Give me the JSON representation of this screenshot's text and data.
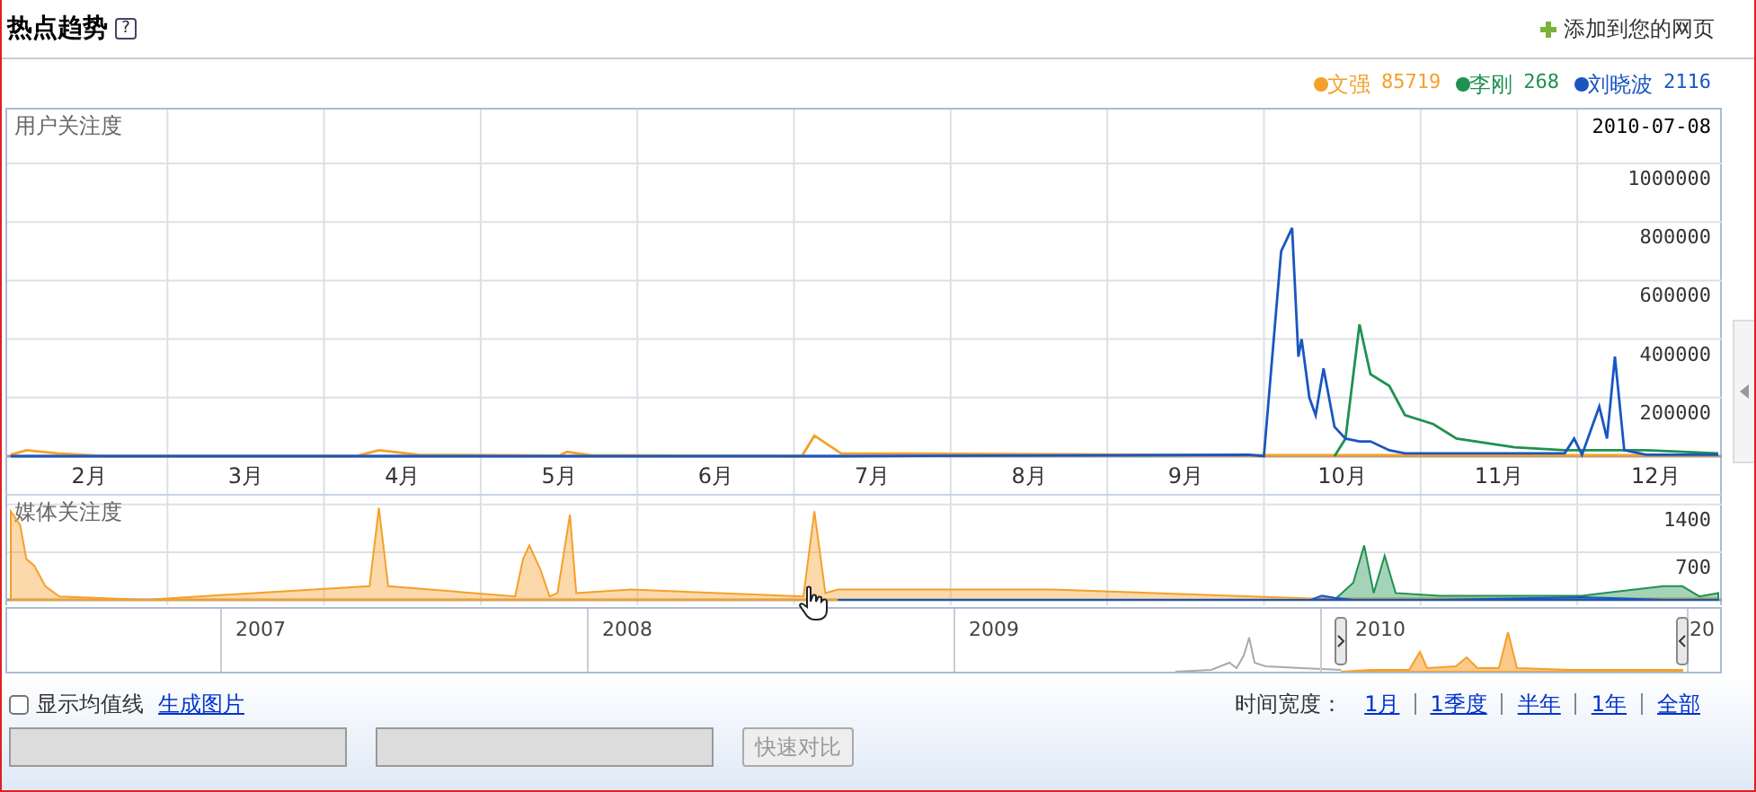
{
  "header": {
    "title": "热点趋势",
    "help": "?",
    "add_link": "添加到您的网页"
  },
  "legend": [
    {
      "reading": "85719"
    },
    {
      "reading": "268"
    },
    {
      "reading": "2116"
    }
  ],
  "user_chart": {
    "date": "2010-07-08",
    "chart_data": {
      "type": "line",
      "title": "用户关注度",
      "grid": true,
      "xlim": [
        2,
        12.9
      ],
      "ylim": [
        0,
        1184000
      ],
      "xticks": [
        {
          "value": 2.5,
          "label": "2月"
        },
        {
          "value": 3.5,
          "label": "3月"
        },
        {
          "value": 4.5,
          "label": "4月"
        },
        {
          "value": 5.5,
          "label": "5月"
        },
        {
          "value": 6.5,
          "label": "6月"
        },
        {
          "value": 7.5,
          "label": "7月"
        },
        {
          "value": 8.5,
          "label": "8月"
        },
        {
          "value": 9.5,
          "label": "9月"
        },
        {
          "value": 10.5,
          "label": "10月"
        },
        {
          "value": 11.5,
          "label": "11月"
        },
        {
          "value": 12.5,
          "label": "12月"
        }
      ],
      "yticks": [
        200000,
        400000,
        600000,
        800000,
        1000000
      ],
      "x": [
        2,
        2.1,
        2.3,
        2.6,
        4.2,
        4.35,
        4.6,
        5.5,
        5.55,
        5.7,
        7.05,
        7.13,
        7.3,
        9.9,
        10.0,
        10.11,
        10.18,
        10.22,
        10.24,
        10.29,
        10.33,
        10.38,
        10.45,
        10.52,
        10.61,
        10.68,
        10.8,
        10.9,
        11.08,
        11.23,
        11.6,
        11.92,
        11.98,
        12.03,
        12.14,
        12.19,
        12.24,
        12.3,
        12.44,
        12.9
      ],
      "series": [
        {
          "name": "文强",
          "color": "#f5a02a",
          "values": [
            5000,
            20000,
            10000,
            0,
            0,
            20000,
            5000,
            2000,
            15000,
            3000,
            0,
            70000,
            10000,
            3000,
            3000,
            3000,
            3000,
            3000,
            3000,
            3000,
            3000,
            3000,
            3000,
            3000,
            3000,
            3000,
            3000,
            3000,
            3000,
            3000,
            3000,
            3000,
            3000,
            3000,
            3000,
            3000,
            3000,
            3000,
            3000,
            3000
          ]
        },
        {
          "name": "李刚",
          "color": "#1f9150",
          "values": [
            null,
            null,
            null,
            null,
            null,
            null,
            null,
            null,
            null,
            null,
            null,
            null,
            null,
            null,
            null,
            null,
            null,
            null,
            null,
            null,
            null,
            null,
            0,
            60000,
            450000,
            280000,
            240000,
            140000,
            110000,
            60000,
            30000,
            20000,
            20000,
            20000,
            20000,
            20000,
            20000,
            20000,
            20000,
            10000
          ]
        },
        {
          "name": "刘晓波",
          "color": "#1a56c0",
          "values": [
            0,
            0,
            0,
            0,
            0,
            0,
            0,
            0,
            0,
            0,
            0,
            0,
            0,
            5000,
            0,
            700000,
            780000,
            340000,
            400000,
            200000,
            140000,
            300000,
            100000,
            60000,
            50000,
            50000,
            20000,
            10000,
            10000,
            10000,
            10000,
            10000,
            60000,
            5000,
            170000,
            60000,
            340000,
            20000,
            5000,
            5000
          ]
        }
      ]
    }
  },
  "media_chart": {
    "chart_data": {
      "type": "area",
      "title": "媒体关注度",
      "grid": true,
      "xlim": [
        2,
        12.9
      ],
      "ylim": [
        0,
        1530
      ],
      "yticks": [
        700,
        1400
      ],
      "x": [
        2,
        2.06,
        2.1,
        2.15,
        2.22,
        2.31,
        2.86,
        3.2,
        4.29,
        4.35,
        4.41,
        5.22,
        5.27,
        5.31,
        5.38,
        5.44,
        5.49,
        5.57,
        5.61,
        5.96,
        7.06,
        7.13,
        7.2,
        7.28,
        8.65,
        10.3,
        10.37,
        10.45,
        10.57,
        10.64,
        10.7,
        10.77,
        10.84,
        11.12,
        12.03,
        12.55,
        12.67,
        12.78,
        12.9
      ],
      "series": [
        {
          "color": "#f5a02a",
          "values": [
            1300,
            1100,
            600,
            500,
            200,
            50,
            0,
            50,
            200,
            1350,
            200,
            50,
            600,
            800,
            450,
            50,
            100,
            1250,
            100,
            150,
            50,
            1300,
            100,
            150,
            150,
            20,
            20,
            20,
            20,
            20,
            20,
            20,
            20,
            20,
            20,
            20,
            20,
            20,
            20
          ]
        },
        {
          "color": "#1f9150",
          "values": [
            null,
            null,
            null,
            null,
            null,
            null,
            null,
            null,
            null,
            null,
            null,
            null,
            null,
            null,
            null,
            null,
            null,
            null,
            null,
            null,
            null,
            null,
            null,
            null,
            null,
            null,
            null,
            0,
            250,
            800,
            100,
            650,
            100,
            60,
            60,
            200,
            200,
            50,
            100
          ]
        },
        {
          "color": "#1a56c0",
          "values": [
            null,
            null,
            null,
            null,
            null,
            null,
            null,
            null,
            null,
            null,
            null,
            null,
            null,
            null,
            null,
            null,
            null,
            null,
            null,
            null,
            null,
            null,
            null,
            0,
            0,
            0,
            60,
            30,
            0,
            0,
            0,
            0,
            0,
            0,
            40,
            0,
            0,
            0,
            0
          ]
        }
      ]
    }
  },
  "navigator": {
    "years": [
      "2007",
      "2008",
      "2009",
      "2010",
      "20"
    ]
  },
  "footer": {
    "average_line": {
      "label": "显示均值线",
      "checked": false
    },
    "image_link": "生成图片",
    "span_label": "时间宽度：",
    "spans": [
      {
        "label": "1月"
      },
      {
        "label": "1季度"
      },
      {
        "label": "半年"
      },
      {
        "label": "1年"
      },
      {
        "label": "全部"
      }
    ],
    "compare_fields": [
      {
        "disabled": true
      },
      {
        "disabled": true
      }
    ],
    "compare_button": {
      "label": "快速对比",
      "disabled": true
    }
  }
}
